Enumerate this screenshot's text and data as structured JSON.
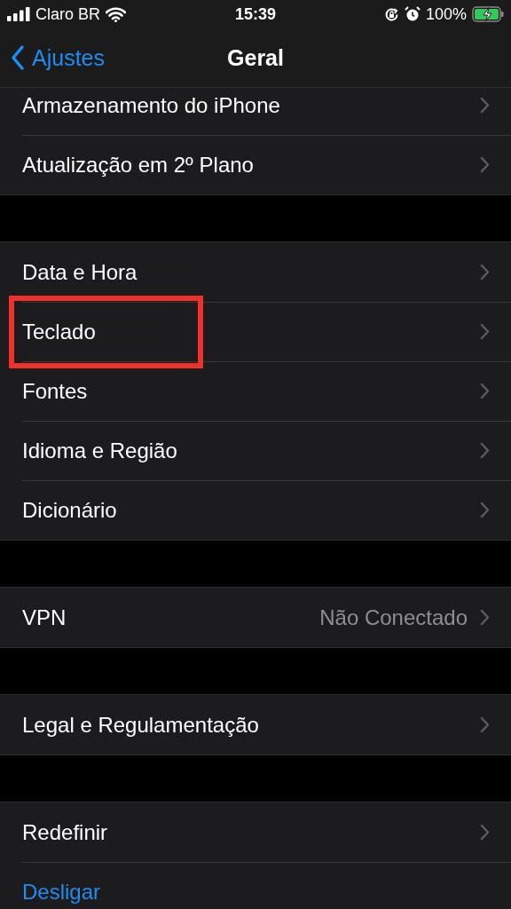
{
  "status_bar": {
    "carrier": "Claro BR",
    "time": "15:39",
    "battery": "100%",
    "charging": true
  },
  "nav": {
    "back": "Ajustes",
    "title": "Geral"
  },
  "groups": [
    {
      "rows": [
        {
          "label": "Armazenamento do iPhone",
          "kind": "link",
          "highlighted": false
        },
        {
          "label": "Atualização em 2º Plano",
          "kind": "link",
          "highlighted": false
        }
      ]
    },
    {
      "rows": [
        {
          "label": "Data e Hora",
          "kind": "link",
          "highlighted": false
        },
        {
          "label": "Teclado",
          "kind": "link",
          "highlighted": true
        },
        {
          "label": "Fontes",
          "kind": "link",
          "highlighted": false
        },
        {
          "label": "Idioma e Região",
          "kind": "link",
          "highlighted": false
        },
        {
          "label": "Dicionário",
          "kind": "link",
          "highlighted": false
        }
      ]
    },
    {
      "rows": [
        {
          "label": "VPN",
          "kind": "link",
          "value": "Não Conectado",
          "highlighted": false
        }
      ]
    },
    {
      "rows": [
        {
          "label": "Legal e Regulamentação",
          "kind": "link",
          "highlighted": false
        }
      ]
    },
    {
      "rows": [
        {
          "label": "Redefinir",
          "kind": "link",
          "highlighted": false
        },
        {
          "label": "Desligar",
          "kind": "action",
          "highlighted": false
        }
      ]
    }
  ]
}
